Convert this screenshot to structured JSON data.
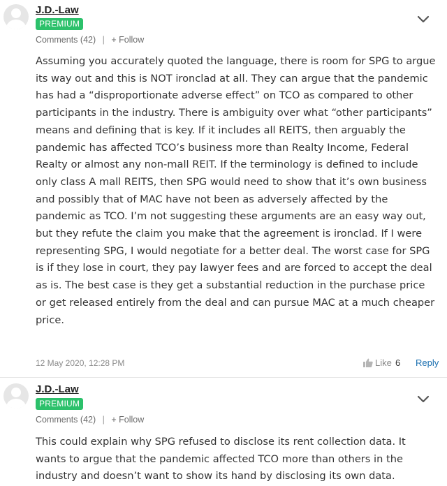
{
  "comments": [
    {
      "author": "J.D.-Law",
      "badge": "PREMIUM",
      "comments_label": "Comments",
      "comments_count": "(42)",
      "separator": "|",
      "follow_label": "+ Follow",
      "text": "Assuming you accurately quoted the language, there is room for SPG to argue its way out and this is NOT ironclad at all. They can argue that the pandemic has had a “disproportionate adverse effect” on TCO as compared to other participants in the industry. There is ambiguity over what “other participants” means and defining that is key. If it includes all REITS, then arguably the pandemic has affected TCO’s business more than Realty Income, Federal Realty or almost any non-mall REIT. If the terminology is defined to include only class A mall REITS, then SPG would need to show that it’s own business and possibly that of MAC have not been as adversely affected by the pandemic as TCO. I’m not suggesting these arguments are an easy way out, but they refute the claim you make that the agreement is ironclad. If I were representing SPG, I would negotiate for a better deal. The worst case for SPG is if they lose in court, they pay lawyer fees and are forced to accept the deal as is. The best case is they get a substantial reduction in the purchase price or get released entirely from the deal and can pursue MAC at a much cheaper price.",
      "date": "12 May 2020, 12:28 PM",
      "like_label": "Like",
      "like_count": "6",
      "reply_label": "Reply"
    },
    {
      "author": "J.D.-Law",
      "badge": "PREMIUM",
      "comments_label": "Comments",
      "comments_count": "(42)",
      "separator": "|",
      "follow_label": "+ Follow",
      "text": "This could explain why SPG refused to disclose its rent collection data. It wants to argue that the pandemic affected TCO more than others in the industry and doesn’t want to show its hand by disclosing its own data."
    }
  ],
  "colors": {
    "premium_badge": "#2cc16b",
    "reply_link": "#1a6fb0",
    "meta_text": "#6b6b6b"
  },
  "icons": {
    "avatar": "default-user-avatar",
    "menu": "chevron-down-icon",
    "like": "thumbs-up-icon"
  }
}
